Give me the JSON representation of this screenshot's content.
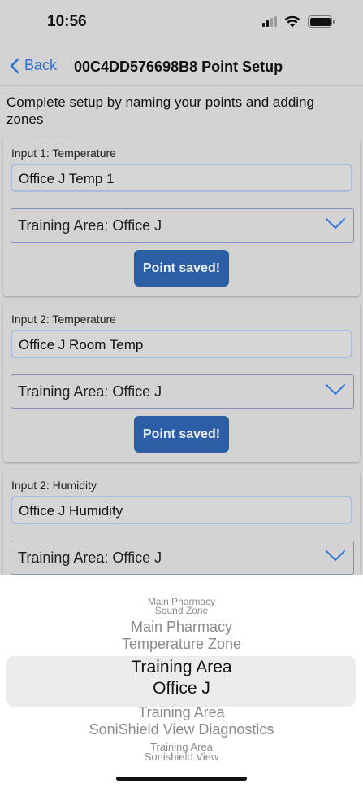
{
  "status_bar": {
    "time": "10:56"
  },
  "nav": {
    "back_label": "Back",
    "title": "00C4DD576698B8 Point Setup"
  },
  "intro_text": "Complete setup by naming your points and adding zones",
  "points": [
    {
      "label": "Input 1: Temperature",
      "name_value": "Office J Temp 1",
      "zone": "Training Area: Office J",
      "button": "Point saved!"
    },
    {
      "label": "Input 2: Temperature",
      "name_value": "Office J Room Temp",
      "zone": "Training Area: Office J",
      "button": "Point saved!"
    },
    {
      "label": "Input 2: Humidity",
      "name_value": "Office J Humidity",
      "zone": "Training Area: Office J"
    }
  ],
  "picker": {
    "options": [
      {
        "line1": "Main Pharmacy",
        "line2": "Sound Zone"
      },
      {
        "line1": "Main Pharmacy",
        "line2": "Temperature Zone"
      },
      {
        "line1": "Training Area",
        "line2": "Office J"
      },
      {
        "line1": "Training Area",
        "line2": "SoniShield View Diagnostics"
      },
      {
        "line1": "Training Area",
        "line2": "Sonishield View"
      }
    ],
    "selected_index": 2
  },
  "colors": {
    "accent": "#2f6fcf",
    "button": "#2c5ea5",
    "background": "#d3d3d3"
  }
}
